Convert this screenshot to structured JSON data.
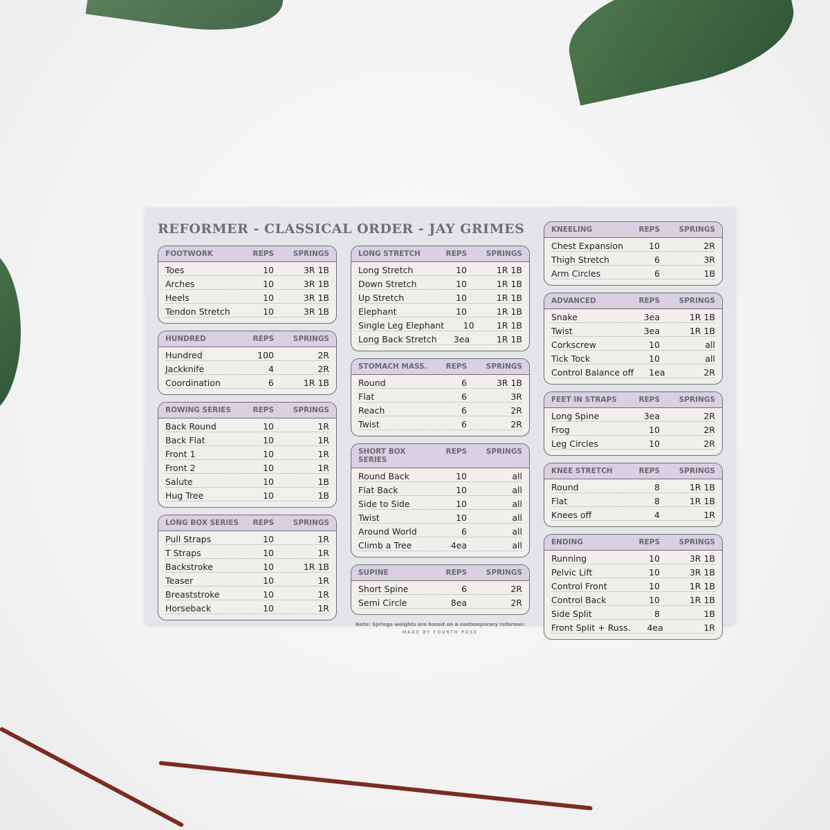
{
  "title": "REFORMER - CLASSICAL ORDER - JAY GRIMES",
  "headers": {
    "reps": "REPS",
    "springs": "SPRINGS"
  },
  "columns": [
    [
      {
        "name": "FOOTWORK",
        "rows": [
          [
            "Toes",
            "10",
            "3R 1B"
          ],
          [
            "Arches",
            "10",
            "3R 1B"
          ],
          [
            "Heels",
            "10",
            "3R 1B"
          ],
          [
            "Tendon Stretch",
            "10",
            "3R 1B"
          ]
        ]
      },
      {
        "name": "HUNDRED",
        "rows": [
          [
            "Hundred",
            "100",
            "2R"
          ],
          [
            "Jackknife",
            "4",
            "2R"
          ],
          [
            "Coordination",
            "6",
            "1R 1B"
          ]
        ]
      },
      {
        "name": "ROWING SERIES",
        "rows": [
          [
            "Back Round",
            "10",
            "1R"
          ],
          [
            "Back Flat",
            "10",
            "1R"
          ],
          [
            "Front 1",
            "10",
            "1R"
          ],
          [
            "Front 2",
            "10",
            "1R"
          ],
          [
            "Salute",
            "10",
            "1B"
          ],
          [
            "Hug Tree",
            "10",
            "1B"
          ]
        ]
      },
      {
        "name": "LONG BOX SERIES",
        "rows": [
          [
            "Pull Straps",
            "10",
            "1R"
          ],
          [
            "T Straps",
            "10",
            "1R"
          ],
          [
            "Backstroke",
            "10",
            "1R 1B"
          ],
          [
            "Teaser",
            "10",
            "1R"
          ],
          [
            "Breaststroke",
            "10",
            "1R"
          ],
          [
            "Horseback",
            "10",
            "1R"
          ]
        ]
      }
    ],
    [
      {
        "name": "LONG STRETCH",
        "rows": [
          [
            "Long Stretch",
            "10",
            "1R 1B"
          ],
          [
            "Down Stretch",
            "10",
            "1R 1B"
          ],
          [
            "Up Stretch",
            "10",
            "1R 1B"
          ],
          [
            "Elephant",
            "10",
            "1R 1B"
          ],
          [
            "Single Leg Elephant",
            "10",
            "1R 1B"
          ],
          [
            "Long Back Stretch",
            "3ea",
            "1R 1B"
          ]
        ]
      },
      {
        "name": "STOMACH MASS.",
        "rows": [
          [
            "Round",
            "6",
            "3R 1B"
          ],
          [
            "Flat",
            "6",
            "3R"
          ],
          [
            "Reach",
            "6",
            "2R"
          ],
          [
            "Twist",
            "6",
            "2R"
          ]
        ]
      },
      {
        "name": "SHORT BOX SERIES",
        "rows": [
          [
            "Round Back",
            "10",
            "all"
          ],
          [
            "Flat Back",
            "10",
            "all"
          ],
          [
            "Side to Side",
            "10",
            "all"
          ],
          [
            "Twist",
            "10",
            "all"
          ],
          [
            "Around World",
            "6",
            "all"
          ],
          [
            "Climb a Tree",
            "4ea",
            "all"
          ]
        ]
      },
      {
        "name": "SUPINE",
        "rows": [
          [
            "Short Spine",
            "6",
            "2R"
          ],
          [
            "Semi Circle",
            "8ea",
            "2R"
          ]
        ]
      }
    ],
    [
      {
        "name": "KNEELING",
        "rows": [
          [
            "Chest Expansion",
            "10",
            "2R"
          ],
          [
            "Thigh Stretch",
            "6",
            "3R"
          ],
          [
            "Arm Circles",
            "6",
            "1B"
          ]
        ]
      },
      {
        "name": "ADVANCED",
        "rows": [
          [
            "Snake",
            "3ea",
            "1R 1B"
          ],
          [
            "Twist",
            "3ea",
            "1R 1B"
          ],
          [
            "Corkscrew",
            "10",
            "all"
          ],
          [
            "Tick Tock",
            "10",
            "all"
          ],
          [
            "Control Balance off",
            "1ea",
            "2R"
          ]
        ]
      },
      {
        "name": "FEET IN STRAPS",
        "rows": [
          [
            "Long Spine",
            "3ea",
            "2R"
          ],
          [
            "Frog",
            "10",
            "2R"
          ],
          [
            "Leg Circles",
            "10",
            "2R"
          ]
        ]
      },
      {
        "name": "KNEE STRETCH",
        "rows": [
          [
            "Round",
            "8",
            "1R 1B"
          ],
          [
            "Flat",
            "8",
            "1R 1B"
          ],
          [
            "Knees off",
            "4",
            "1R"
          ]
        ]
      },
      {
        "name": "ENDING",
        "rows": [
          [
            "Running",
            "10",
            "3R 1B"
          ],
          [
            "Pelvic Lift",
            "10",
            "3R 1B"
          ],
          [
            "Control Front",
            "10",
            "1R 1B"
          ],
          [
            "Control Back",
            "10",
            "1R 1B"
          ],
          [
            "Side Split",
            "8",
            "1B"
          ],
          [
            "Front Split + Russ.",
            "4ea",
            "1R"
          ]
        ]
      }
    ]
  ],
  "note": "Note: Springs weights are based on a contemporary reformer.",
  "made_by": "MADE BY FOURTH POSE"
}
